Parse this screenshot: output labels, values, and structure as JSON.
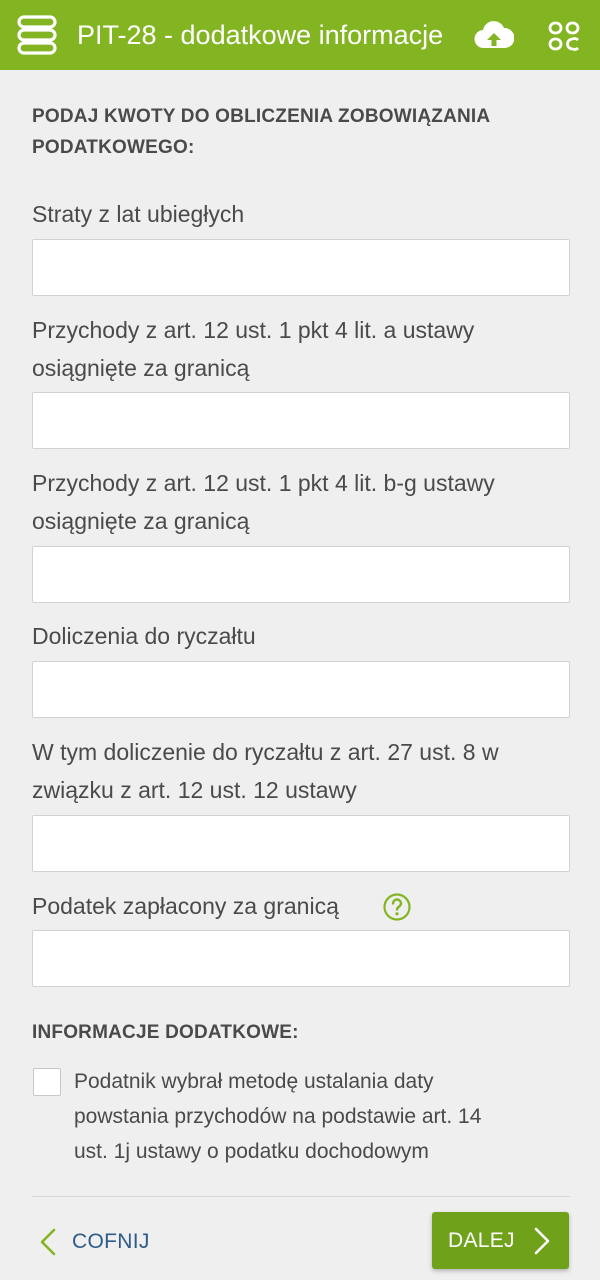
{
  "header": {
    "title": "PIT-28 - dodatkowe informacje",
    "icons": [
      "menu-icon",
      "cloud-upload-icon",
      "apps-grid-icon"
    ],
    "background_color": "#83b523"
  },
  "section_amounts": {
    "heading_line1": "PODAJ KWOTY DO OBLICZENIA ZOBOWIĄZANIA",
    "heading_line2": "PODATKOWEGO:"
  },
  "fields": [
    {
      "label_line1": "Straty z lat ubiegłych",
      "label_line2": "",
      "value": ""
    },
    {
      "label_line1": "Przychody z art. 12 ust. 1 pkt 4 lit. a ustawy",
      "label_line2": "osiągnięte za granicą",
      "value": ""
    },
    {
      "label_line1": "Przychody z art. 12 ust. 1 pkt 4 lit. b-g ustawy",
      "label_line2": "osiągnięte za granicą",
      "value": ""
    },
    {
      "label_line1": "Doliczenia do ryczałtu",
      "label_line2": "",
      "value": ""
    },
    {
      "label_line1": "W tym doliczenie do ryczałtu z art. 27 ust. 8 w",
      "label_line2": "związku z art. 12 ust. 12 ustawy",
      "value": ""
    },
    {
      "label_line1": "Podatek zapłacony za granicą",
      "label_line2": "",
      "value": "",
      "help_icon": "question-icon"
    }
  ],
  "section_additional": {
    "heading": "INFORMACJE DODATKOWE:"
  },
  "checkbox": {
    "checked": false,
    "label_line1": "Podatnik wybrał metodę ustalania daty",
    "label_line2": "powstania przychodów na podstawie art. 14",
    "label_line3": "ust. 1j ustawy o podatku dochodowym"
  },
  "footer": {
    "back_label": "COFNIJ",
    "next_label": "DALEJ",
    "accent_color": "#6fa11b"
  }
}
